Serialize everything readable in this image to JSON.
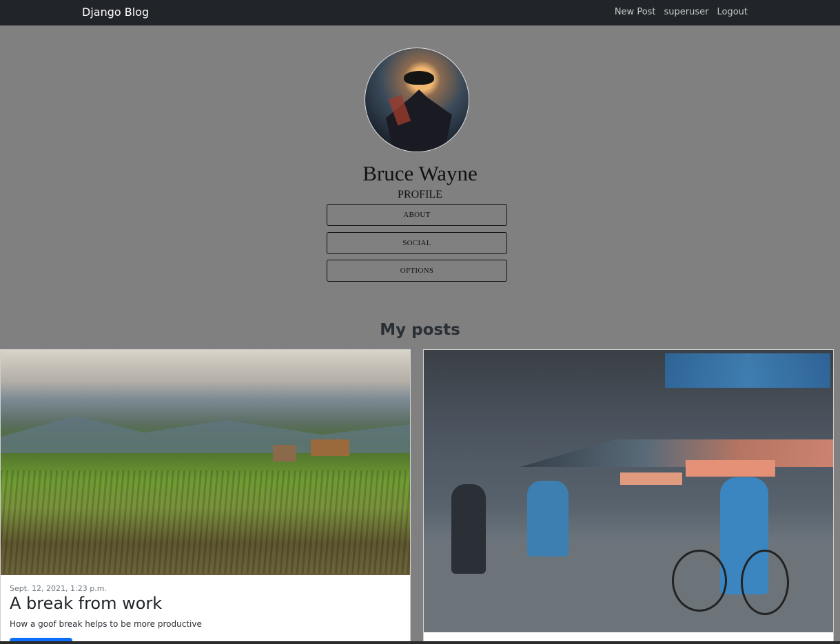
{
  "navbar": {
    "brand": "Django Blog",
    "links": [
      "New Post",
      "superuser",
      "Logout"
    ]
  },
  "profile": {
    "name": "Bruce Wayne",
    "heading": "PROFILE",
    "buttons": [
      "ABOUT",
      "SOCIAL",
      "OPTIONS"
    ]
  },
  "section_title": "My posts",
  "posts": [
    {
      "date": "Sept. 12, 2021, 1:23 p.m.",
      "title": "A break from work",
      "summary": "How a goof break helps to be more productive"
    }
  ],
  "colors": {
    "navbar_bg": "#212529",
    "page_bg": "#808080",
    "accent": "#0d6efd"
  },
  "icons": [
    "avatar-image"
  ]
}
